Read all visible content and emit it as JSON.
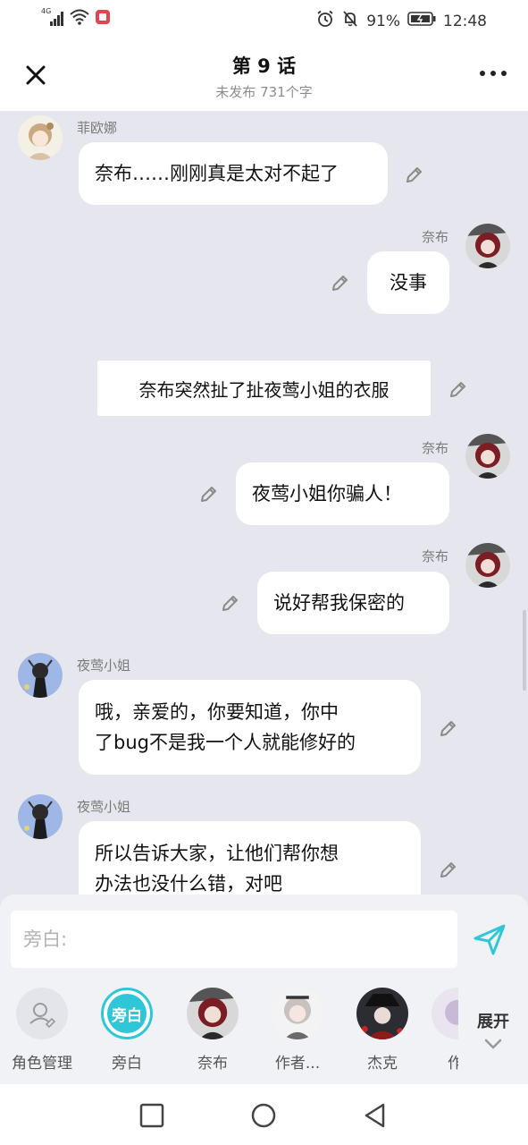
{
  "status_bar": {
    "network": "4G",
    "battery": "91%",
    "time": "12:48"
  },
  "header": {
    "title": "第 9 话",
    "subtitle": "未发布 731个字"
  },
  "messages": [
    {
      "speaker": "菲欧娜",
      "text": "奈布……刚刚真是太对不起了",
      "side": "left"
    },
    {
      "speaker": "奈布",
      "text": "没事",
      "side": "right"
    },
    {
      "speaker": "",
      "text": "奈布突然扯了扯夜莺小姐的衣服",
      "side": "narration"
    },
    {
      "speaker": "奈布",
      "text": "夜莺小姐你骗人！",
      "side": "right"
    },
    {
      "speaker": "奈布",
      "text": "说好帮我保密的",
      "side": "right"
    },
    {
      "speaker": "夜莺小姐",
      "line1": "哦，亲爱的，你要知道，你中",
      "line2": "了bug不是我一个人就能修好的",
      "side": "left"
    },
    {
      "speaker": "夜莺小姐",
      "line1": "所以告诉大家，让他们帮你想",
      "line2": "办法也没什么错，对吧",
      "side": "left"
    }
  ],
  "composer": {
    "placeholder": "旁白:"
  },
  "roles": [
    {
      "label": "角色管理",
      "icon": "role-manage-icon"
    },
    {
      "label": "旁白",
      "badge": "旁白"
    },
    {
      "label": "奈布"
    },
    {
      "label": "作者..."
    },
    {
      "label": "杰克"
    },
    {
      "label": "作"
    }
  ],
  "expand_label": "展开",
  "colors": {
    "accent": "#2fc7d8",
    "background": "#e6e7ee",
    "bubble": "#ffffff"
  }
}
